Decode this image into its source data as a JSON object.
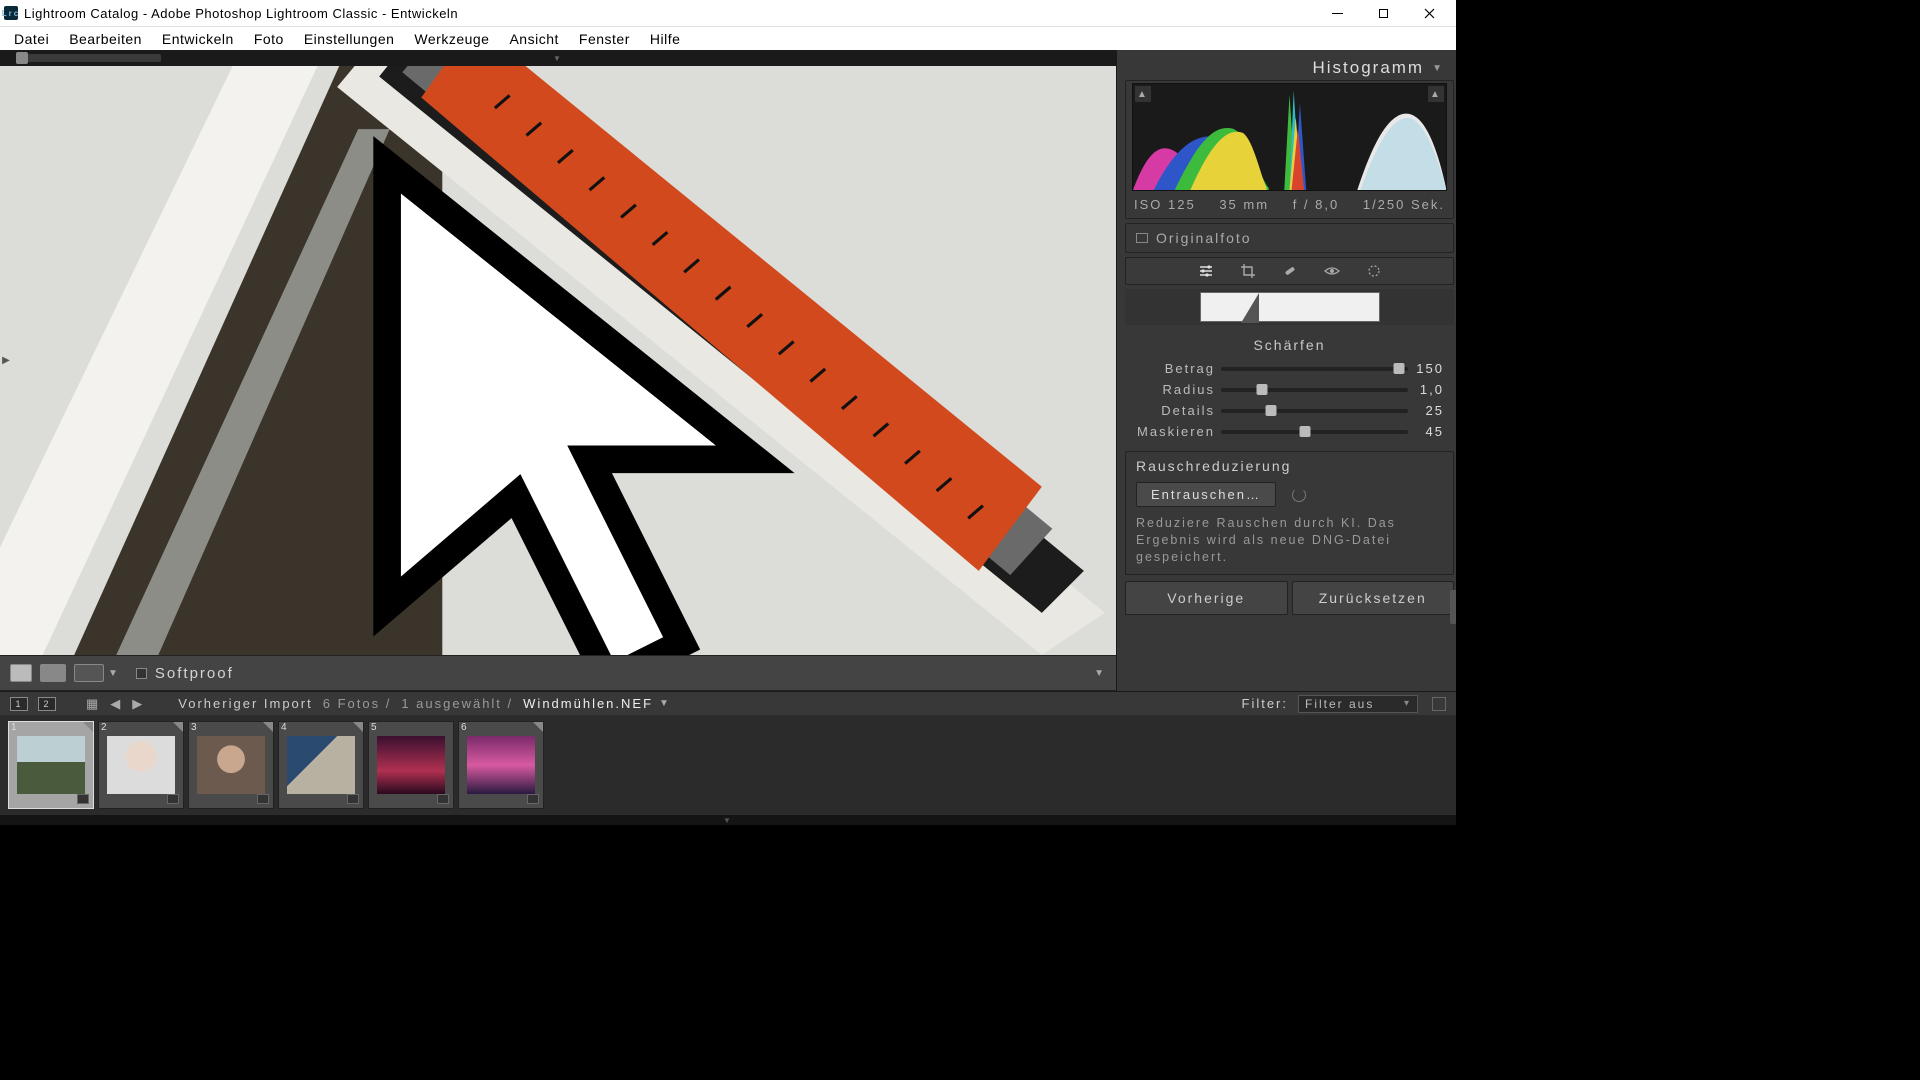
{
  "window": {
    "title": "Lightroom Catalog - Adobe Photoshop Lightroom Classic - Entwickeln"
  },
  "menu": {
    "items": [
      "Datei",
      "Bearbeiten",
      "Entwickeln",
      "Foto",
      "Einstellungen",
      "Werkzeuge",
      "Ansicht",
      "Fenster",
      "Hilfe"
    ]
  },
  "softproof": {
    "label": "Softproof"
  },
  "right_panel": {
    "histogram_label": "Histogramm",
    "exif": {
      "iso": "ISO 125",
      "focal": "35 mm",
      "aperture": "f / 8,0",
      "shutter": "1/250 Sek."
    },
    "original_label": "Originalfoto",
    "sharpen_title": "Schärfen",
    "sliders": {
      "betrag": {
        "name": "Betrag",
        "value": "150",
        "pos": 95
      },
      "radius": {
        "name": "Radius",
        "value": "1,0",
        "pos": 22
      },
      "details": {
        "name": "Details",
        "value": "25",
        "pos": 27
      },
      "mask": {
        "name": "Maskieren",
        "value": "45",
        "pos": 45
      }
    },
    "denoise": {
      "title": "Rauschreduzierung",
      "button": "Entrauschen…",
      "desc": "Reduziere Rauschen durch KI. Das Ergebnis wird als neue DNG-Datei gespeichert."
    },
    "prev_btn": "Vorherige",
    "reset_btn": "Zurücksetzen"
  },
  "fs_head": {
    "source": "Vorheriger Import",
    "count": "6 Fotos /",
    "selected": "1 ausgewählt /",
    "filename": "Windmühlen.NEF",
    "filter_label": "Filter:",
    "filter_value": "Filter aus"
  },
  "thumbs": [
    "1",
    "2",
    "3",
    "4",
    "5",
    "6"
  ]
}
